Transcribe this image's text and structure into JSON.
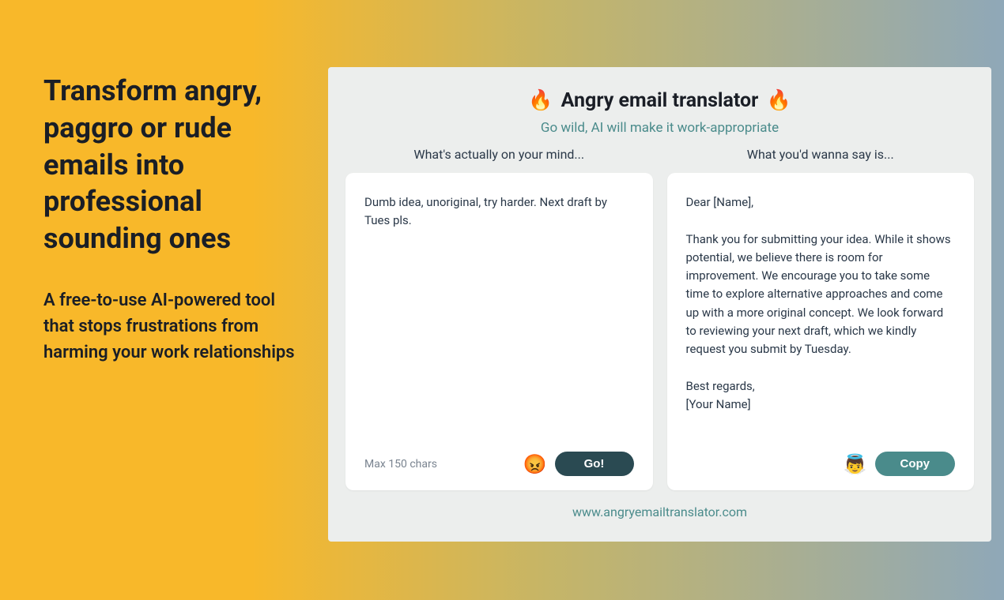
{
  "marketing": {
    "headline": "Transform angry, paggro or rude emails into professional sounding ones",
    "subheadline": "A free-to-use AI-powered tool that stops frustrations from harming your work relationships"
  },
  "app": {
    "title_icon": "🔥",
    "title": "Angry email translator",
    "tagline": "Go wild, AI will make it work-appropriate",
    "input": {
      "label": "What's actually on your mind...",
      "value": "Dumb idea, unoriginal, try harder. Next draft by Tues pls.",
      "char_limit": "Max 150 chars",
      "emoji": "😡",
      "button_label": "Go!"
    },
    "output": {
      "label": "What you'd wanna say is...",
      "value": "Dear [Name],\n\nThank you for submitting your idea. While it shows potential, we believe there is room for improvement. We encourage you to take some time to explore alternative approaches and come up with a more original concept. We look forward to reviewing your next draft, which we kindly request you submit by Tuesday.\n\nBest regards,\n[Your Name]",
      "emoji": "👼",
      "button_label": "Copy"
    },
    "url": "www.angryemailtranslator.com"
  }
}
